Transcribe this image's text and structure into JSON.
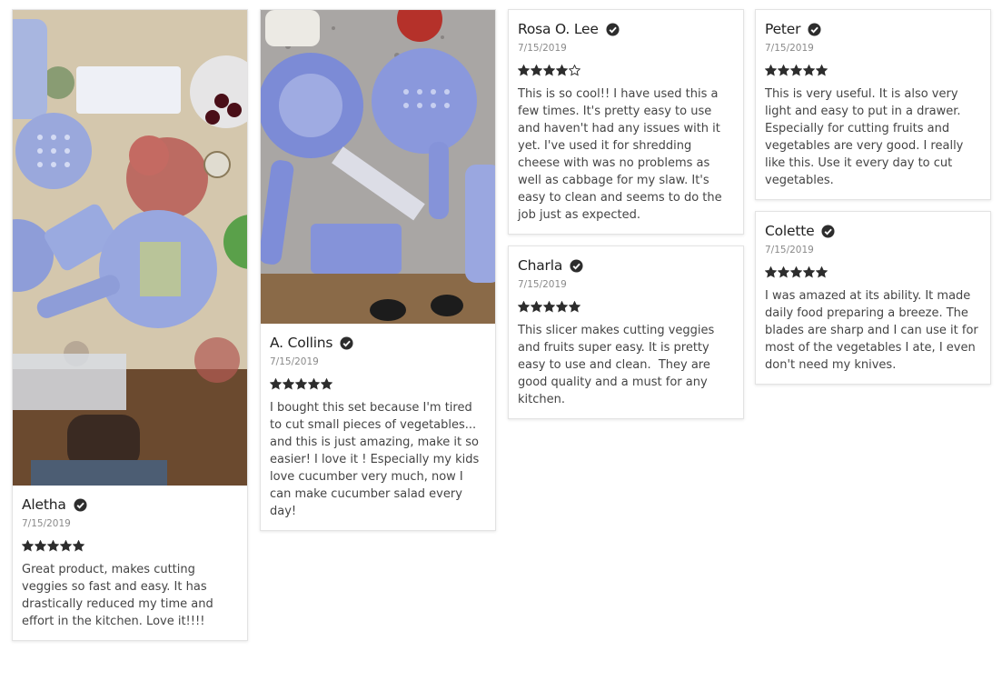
{
  "reviews": [
    {
      "name": "Aletha",
      "date": "7/15/2019",
      "rating": 5,
      "text": "Great product, makes cutting veggies so fast and easy. It has drastically reduced my time and effort in the kitchen. Love it!!!!",
      "verified_icon": "check-circle-icon"
    },
    {
      "name": "A. Collins",
      "date": "7/15/2019",
      "rating": 5,
      "text": "I bought this set because I'm tired to cut small pieces of vegetables... and this is just amazing, make it so easier! I love it ! Especially my kids love cucumber very much, now I can make cucumber salad every day!",
      "verified_icon": "check-circle-icon"
    },
    {
      "name": "Rosa O. Lee",
      "date": "7/15/2019",
      "rating": 4,
      "text": "This is so cool!! I have used this a few times. It's pretty easy to use and haven't had any issues with it yet. I've used it for shredding cheese with was no problems as well as cabbage for my slaw. It's easy to clean and seems to do the job just as expected.",
      "verified_icon": "check-circle-icon"
    },
    {
      "name": "Charla",
      "date": "7/15/2019",
      "rating": 5,
      "text": "This slicer makes cutting veggies and fruits super easy. It is pretty easy to use and clean.  They are good quality and a must for any kitchen.",
      "verified_icon": "check-circle-icon"
    },
    {
      "name": "Peter",
      "date": "7/15/2019",
      "rating": 5,
      "text": "This is very useful. It is also very light and easy to put in a drawer. Especially for cutting fruits and vegetables are very good. I really like this. Use it every day to cut vegetables.",
      "verified_icon": "check-circle-icon"
    },
    {
      "name": "Colette",
      "date": "7/15/2019",
      "rating": 5,
      "text": "I was amazed at its ability. It made daily food preparing a breeze. The blades are sharp and I can use it for most of the vegetables I ate, I even don't need my knives.",
      "verified_icon": "check-circle-icon"
    }
  ],
  "colors": {
    "star": "#2d2d2d",
    "star_empty": "#ffffff",
    "accent_blue": "#8b98dc"
  }
}
